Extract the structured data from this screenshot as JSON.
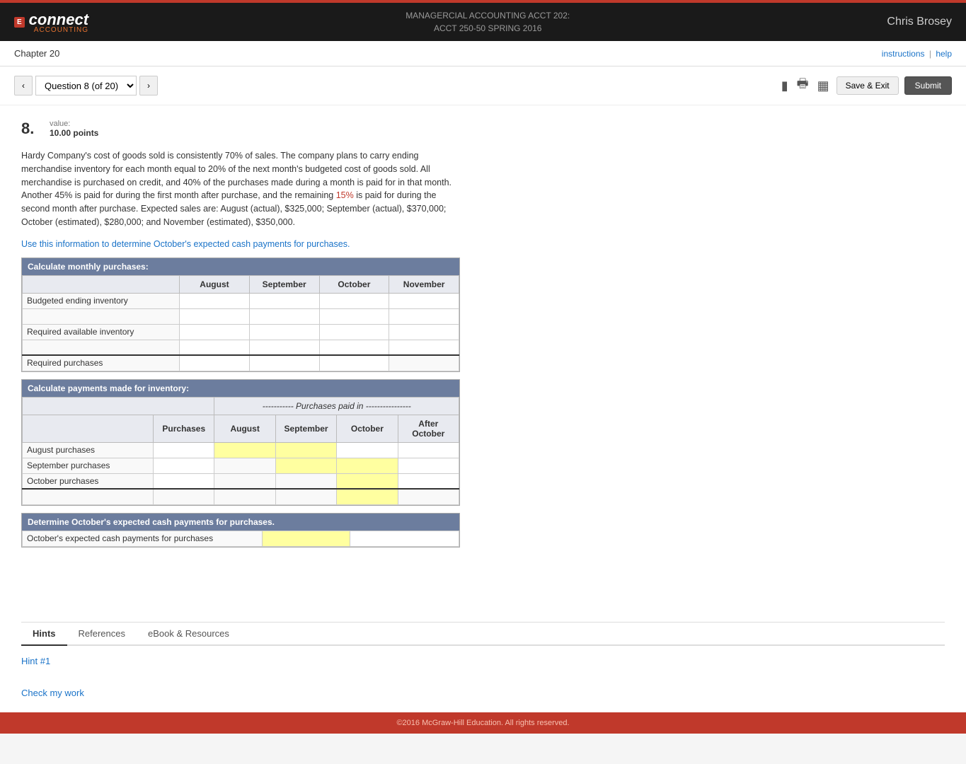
{
  "header": {
    "logo_icon": "E",
    "logo_text": "connect",
    "logo_sub": "ACCOUNTING",
    "course_line1": "MANAGERCIAL ACCOUNTING ACCT 202:",
    "course_line2": "ACCT 250-50 SPRING 2016",
    "user_name": "Chris Brosey"
  },
  "sub_nav": {
    "chapter": "Chapter 20",
    "links": {
      "instructions": "instructions",
      "separator": "|",
      "help": "help"
    }
  },
  "question_nav": {
    "prev_label": "‹",
    "next_label": "›",
    "selector": "Question 8 (of 20)",
    "save_exit": "Save & Exit",
    "submit": "Submit"
  },
  "question": {
    "number": "8.",
    "value_label": "value:",
    "points": "10.00 points"
  },
  "problem": {
    "text": "Hardy Company's cost of goods sold is consistently 70% of sales. The company plans to carry ending merchandise inventory for each month equal to 20% of the next month's budgeted cost of goods sold. All merchandise is purchased on credit, and 40% of the purchases made during a month is paid for in that month. Another 45% is paid for during the first month after purchase, and the remaining 15% is paid for during the second month after purchase. Expected sales are: August (actual), $325,000; September (actual), $370,000; October (estimated), $280,000; and November (estimated), $350,000.",
    "instruction": "Use this information to determine October's expected cash payments for purchases."
  },
  "table1": {
    "header": "Calculate monthly purchases:",
    "columns": [
      "",
      "August",
      "September",
      "October",
      "November"
    ],
    "rows": [
      {
        "label": "Budgeted ending inventory",
        "cells": [
          "",
          "",
          "",
          ""
        ]
      },
      {
        "label": "",
        "cells": [
          "",
          "",
          "",
          ""
        ]
      },
      {
        "label": "Required available inventory",
        "cells": [
          "",
          "",
          "",
          ""
        ]
      },
      {
        "label": "",
        "cells": [
          "",
          "",
          "",
          ""
        ]
      },
      {
        "label": "Required purchases",
        "cells": [
          "",
          "",
          "",
          ""
        ]
      }
    ]
  },
  "table2": {
    "header": "Calculate payments made for inventory:",
    "purchases_header": "----------- Purchases paid in ----------------",
    "columns": [
      "",
      "Purchases",
      "August",
      "September",
      "October",
      "After October"
    ],
    "rows": [
      {
        "label": "August purchases",
        "cells": [
          "",
          "",
          "",
          "",
          ""
        ]
      },
      {
        "label": "September purchases",
        "cells": [
          "",
          "",
          "",
          "",
          ""
        ]
      },
      {
        "label": "October purchases",
        "cells": [
          "",
          "",
          "",
          "",
          ""
        ]
      },
      {
        "label": "",
        "cells": [
          "",
          "",
          "",
          "",
          ""
        ]
      }
    ]
  },
  "table3": {
    "header": "Determine October's expected cash payments for purchases.",
    "rows": [
      {
        "label": "October's expected cash payments for purchases",
        "cells": [
          "",
          ""
        ]
      }
    ]
  },
  "tabs": {
    "items": [
      "Hints",
      "References",
      "eBook & Resources"
    ],
    "active": "Hints"
  },
  "hints": {
    "hint1": "Hint #1"
  },
  "check_work": "Check my work",
  "footer": {
    "text": "©2016 McGraw-Hill Education. All rights reserved."
  }
}
